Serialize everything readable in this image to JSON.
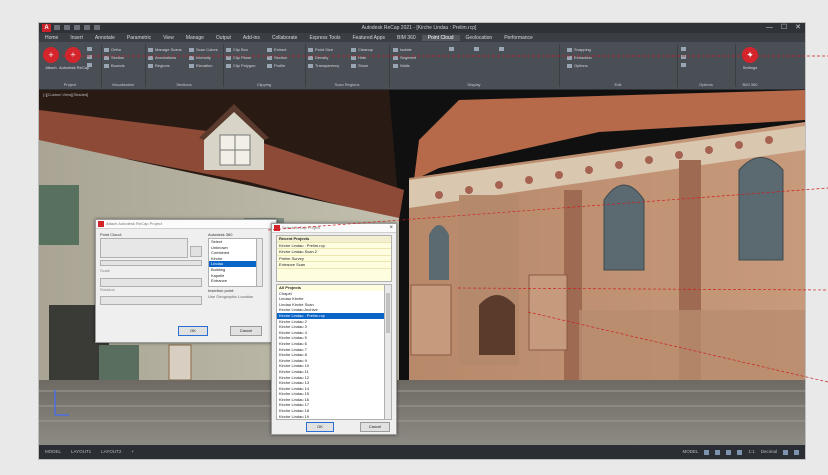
{
  "window": {
    "title": "Autodesk ReCap 2021 - [Kirche Lindau : Prelim.rcp]",
    "minimize": "—",
    "maximize": "☐",
    "close": "✕",
    "logo": "A"
  },
  "ribbon_tabs": [
    "Home",
    "Insert",
    "Annotate",
    "Parametric",
    "View",
    "Manage",
    "Output",
    "Add-ins",
    "Collaborate",
    "Express Tools",
    "Featured Apps",
    "BIM 360",
    "Point Cloud",
    "Geolocation",
    "Performance"
  ],
  "active_tab": "Point Cloud",
  "ribbon": {
    "btn1": "Attach",
    "btn2": "Autodesk ReCap",
    "group1_rows": [
      "Ortho",
      "Section",
      "Bounds"
    ],
    "group2_rows": [
      "Manage Scans",
      "Annotations",
      "Regions"
    ],
    "group3_rows": [
      "Scan Colors",
      "Intensity",
      "Elevation"
    ],
    "group4_rows": [
      "Clip Box",
      "Clip Plane",
      "Clip Polygon"
    ],
    "group5_rows": [
      "Extract",
      "Section",
      "Profile"
    ],
    "group6_rows": [
      "Point Size",
      "Density",
      "Transparency"
    ],
    "group7_rows": [
      "Cleanup",
      "Hide",
      "Show"
    ],
    "group8_rows": [
      "Isolate",
      "Segment",
      "Walls"
    ],
    "group9_rows": [
      "Snapping",
      "Extraction",
      "Options"
    ],
    "btn3": "Settings",
    "group_labels": [
      "Project",
      "Visualization",
      "Sections",
      "Clipping",
      "Scan Regions",
      "Display",
      "Edit",
      "Options",
      "BIM 360"
    ]
  },
  "scene_label": "[-][Custom View][Shaded]",
  "dialog_left": {
    "title": "Attach Autodesk ReCap Project",
    "path_label": "Point Cloud:",
    "list_title": "Autodesk 360",
    "list_items": [
      "Select",
      "Unknown",
      "Combined",
      "Kirche",
      "Lindau",
      "Building",
      "Kapelle",
      "Entrance"
    ],
    "selected_item": "Lindau",
    "insertion_label": "Insertion point:",
    "scale_label": "Scale",
    "rotation_label": "Rotation",
    "note": "Use Geographic Location",
    "ok": "OK",
    "cancel": "Cancel"
  },
  "dialog_right": {
    "title": "Select ReCap Project",
    "recent_label": "Recent Projects",
    "recent_items": [
      "Kirche Lindau : Prelim.rcp",
      "Kirche Lindau Scan 2",
      "Prelim Survey",
      "Entrance Scan"
    ],
    "all_label": "All Projects",
    "items": [
      "Chapel",
      "Lindau Kirche",
      "Lindau Kirche Scan",
      "Kirche Lindau Archive",
      "Kirche Lindau : Prelim.rcp",
      "Kirche Lindau 2",
      "Kirche Lindau 3",
      "Kirche Lindau 4",
      "Kirche Lindau 5",
      "Kirche Lindau 6",
      "Kirche Lindau 7",
      "Kirche Lindau 8",
      "Kirche Lindau 9",
      "Kirche Lindau 10",
      "Kirche Lindau 11",
      "Kirche Lindau 12",
      "Kirche Lindau 13",
      "Kirche Lindau 14",
      "Kirche Lindau 15",
      "Kirche Lindau 16",
      "Kirche Lindau 17",
      "Kirche Lindau 18",
      "Kirche Lindau 19",
      "Kirche Lindau 20"
    ],
    "selected_item": "Kirche Lindau : Prelim.rcp",
    "ok": "OK",
    "cancel": "Cancel"
  },
  "statusbar": {
    "left": [
      "MODEL",
      "LAYOUT1",
      "LAYOUT2",
      "+"
    ],
    "right": [
      "MODEL",
      "1:1",
      "Decimal"
    ]
  },
  "colors": {
    "accent": "#d3252b",
    "selection": "#0a64c8",
    "callout_line": "#cc1f1f"
  }
}
